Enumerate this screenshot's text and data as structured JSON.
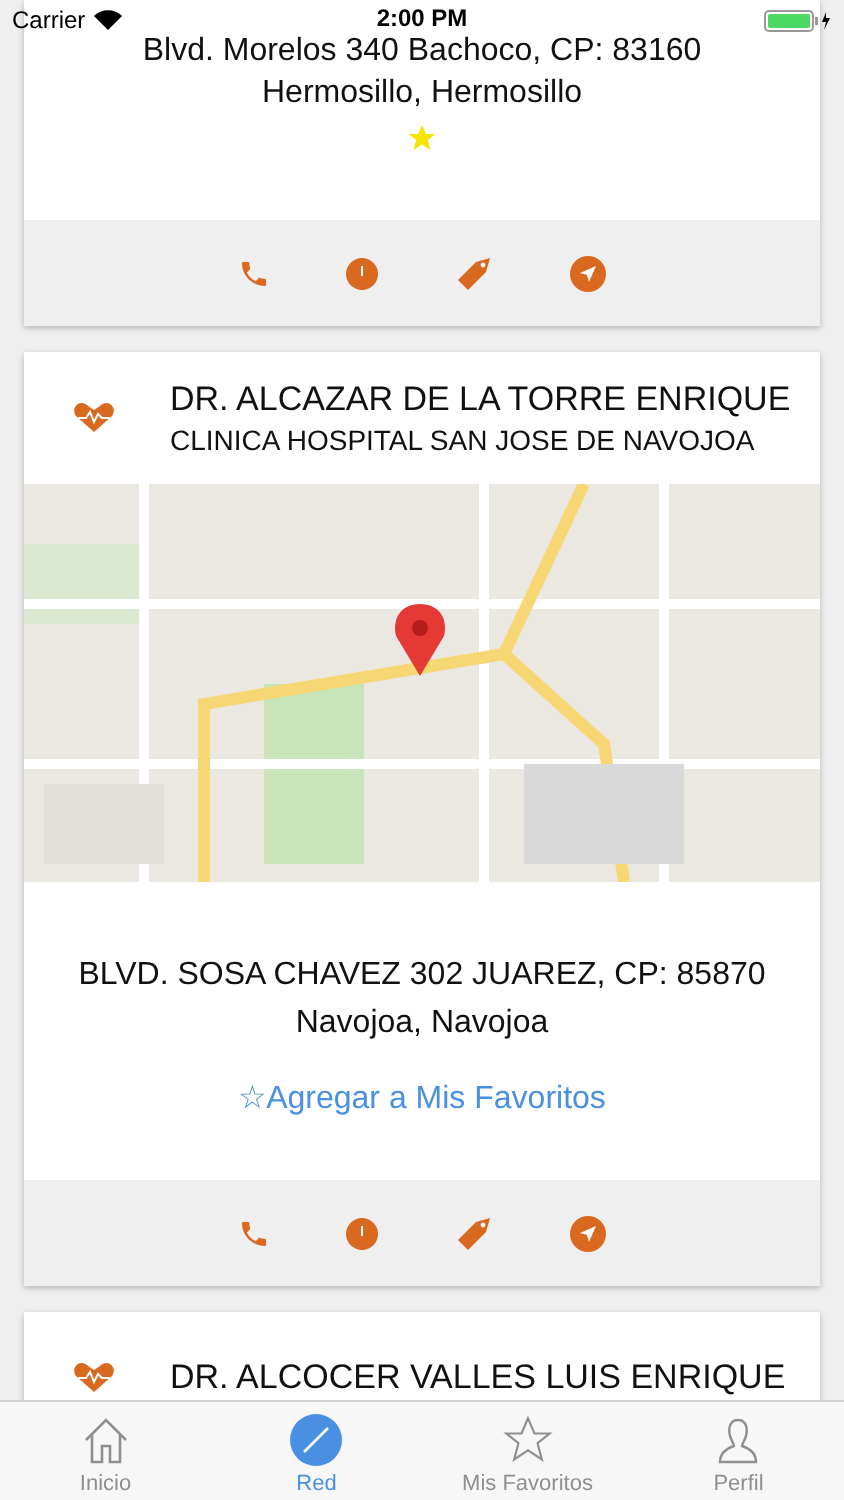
{
  "status_bar": {
    "carrier": "Carrier",
    "time": "2:00 PM"
  },
  "cards": [
    {
      "address": "Blvd. Morelos 340 Bachoco, CP: 83160",
      "city": "Hermosillo, Hermosillo",
      "favorite": true
    },
    {
      "name": "DR. ALCAZAR DE LA TORRE ENRIQUE",
      "clinic": "CLINICA HOSPITAL SAN JOSE DE NAVOJOA",
      "address": "BLVD. SOSA CHAVEZ 302 JUAREZ, CP: 85870",
      "city": "Navojoa, Navojoa",
      "favorite": false,
      "favorite_link": "☆Agregar a Mis Favoritos"
    },
    {
      "name": "DR. ALCOCER VALLES LUIS ENRIQUE"
    }
  ],
  "tabs": [
    {
      "kind": "home",
      "label": "Inicio",
      "selected": false
    },
    {
      "kind": "compass",
      "label": "Red",
      "selected": true
    },
    {
      "kind": "star",
      "label": "Mis Favoritos",
      "selected": false
    },
    {
      "kind": "person",
      "label": "Perfil",
      "selected": false
    }
  ]
}
